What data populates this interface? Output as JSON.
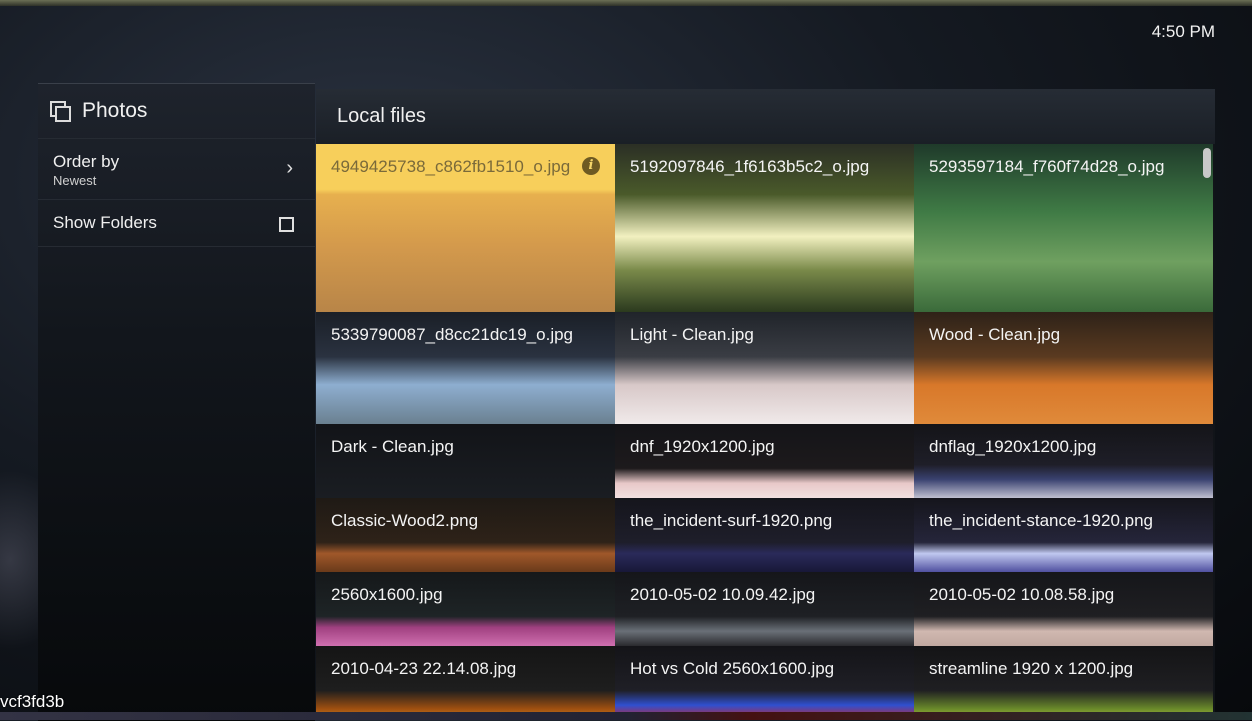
{
  "clock": "4:50 PM",
  "sidebar": {
    "title": "Photos",
    "order_label": "Order by",
    "order_value": "Newest",
    "folders_label": "Show Folders"
  },
  "panel": {
    "title": "Local files"
  },
  "files": [
    {
      "name": "4949425738_c862fb1510_o.jpg",
      "selected": true,
      "bg": "linear-gradient(#f6c95a 0%, #f0b85a 25%, #c98a4a 60%, #b27a45 100%)"
    },
    {
      "name": "5192097846_1f6163b5c2_o.jpg",
      "bg": "linear-gradient(#2b2f25 0%, #4a5a2a 30%, #f2f0c0 55%, #7a8a4a 75%, #2b3a1e 100%)"
    },
    {
      "name": "5293597184_f760f74d28_o.jpg",
      "bg": "linear-gradient(#1f3a2a 0%, #3f7a45 40%, #6fa060 70%, #3a6a3a 100%)"
    },
    {
      "name": "5339790087_d8cc21dc19_o.jpg",
      "bg": "linear-gradient(#1a1f27 0%, #2a3240 40%, #8eaed0 65%, #6a8090 100%)"
    },
    {
      "name": "Light - Clean.jpg",
      "bg": "linear-gradient(#20242a 0%, #3a3d44 40%, #d8c8c8 65%, #f0eaea 100%)"
    },
    {
      "name": "Wood - Clean.jpg",
      "bg": "linear-gradient(#2e2218 0%, #5a3a20 40%, #d8782a 65%, #e08a3a 100%)"
    },
    {
      "name": "Dark - Clean.jpg",
      "bg": "linear-gradient(#121418 0%, #1a1d22 100%)"
    },
    {
      "name": "dnf_1920x1200.jpg",
      "bg": "linear-gradient(#141418 0%, #1d1a1c 60%, #e8c8c8 80%, #f2e0e0 100%)"
    },
    {
      "name": "dnflag_1920x1200.jpg",
      "bg": "linear-gradient(#141418 0%, #1e1e28 55%, #3a4270 75%, #c0c0d0 100%)"
    },
    {
      "name": "Classic-Wood2.png",
      "bg": "linear-gradient(#1f1a15 0%, #2e2218 60%, #a0582a 75%, #6a3a1a 100%)"
    },
    {
      "name": "the_incident-surf-1920.png",
      "bg": "linear-gradient(#15151c 0%, #1e1e2a 60%, #2a2a5a 75%, #181838 100%)"
    },
    {
      "name": "the_incident-stance-1920.png",
      "bg": "linear-gradient(#15151c 0%, #25253a 60%, #c0c8f0 75%, #5050a0 100%)"
    },
    {
      "name": "2560x1600.jpg",
      "bg": "linear-gradient(#15181a 0%, #1e2426 60%, #a04080 75%, #d070b0 100%)"
    },
    {
      "name": "2010-05-02 10.09.42.jpg",
      "bg": "linear-gradient(#15161a 0%, #1e2024 60%, #6a7078 80%, #2a2a2e 100%)"
    },
    {
      "name": "2010-05-02 10.08.58.jpg",
      "bg": "linear-gradient(#15161a 0%, #1f1f22 60%, #d0b8b0 80%, #c0a8a0 100%)"
    },
    {
      "name": "2010-04-23 22.14.08.jpg",
      "bg": "linear-gradient(#151515 0%, #1e1e1e 60%, #a05010 85%, #d08020 100%)"
    },
    {
      "name": "Hot vs Cold 2560x1600.jpg",
      "bg": "linear-gradient(#141418 0%, #1f1f26 60%, #3050d0 80%, #d02020 100%)"
    },
    {
      "name": "streamline 1920 x 1200.jpg",
      "bg": "linear-gradient(#141416 0%, #1f1f22 60%, #6a8a2a 85%, #b0c040 100%)"
    }
  ],
  "watermark": "vcf3fd3b"
}
